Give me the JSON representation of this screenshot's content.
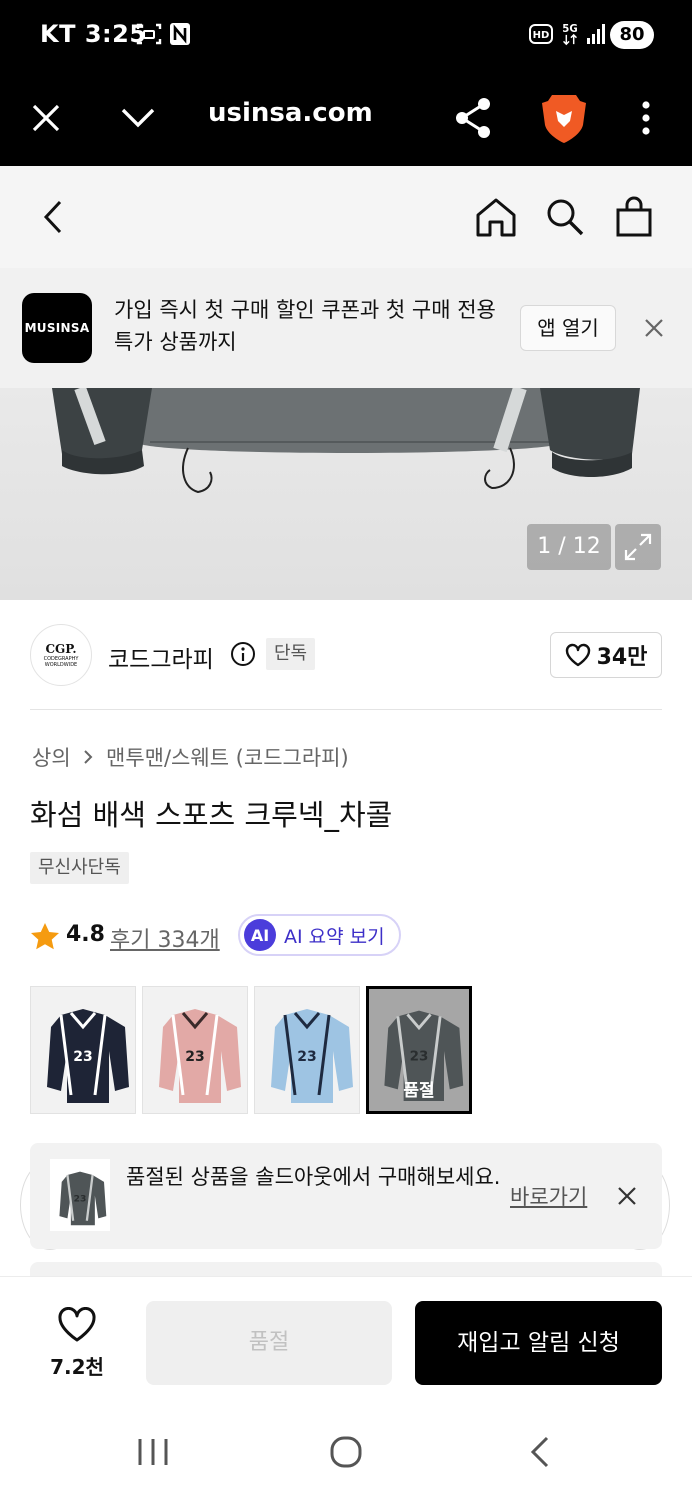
{
  "status_bar": {
    "carrier_time": "KT 3:25",
    "battery": "80"
  },
  "browser": {
    "url": "usinsa.com"
  },
  "app_banner": {
    "logo_text": "MUSINSA",
    "message": "가입 즉시 첫 구매 할인 쿠폰과 첫 구매 전용 특가 상품까지",
    "open_app_label": "앱 열기"
  },
  "gallery": {
    "counter": "1 / 12"
  },
  "brand": {
    "logo_main": "CGP.",
    "logo_sub": "CODEGRAPHY WORLDWIDE",
    "name": "코드그라피",
    "exclusive_tag": "단독",
    "like_count": "34만"
  },
  "breadcrumb": {
    "category": "상의",
    "subcategory": "맨투맨/스웨트 (코드그라피)"
  },
  "product": {
    "title": "화섬 배색 스포츠 크루넥_차콜",
    "tag": "무신사단독",
    "rating": "4.8",
    "reviews": "후기 334개",
    "ai_badge": "AI",
    "ai_label": "AI 요약 보기"
  },
  "options": [
    {
      "color": "#1e2436",
      "accent": "#ffffff",
      "number": "23"
    },
    {
      "color": "#e2a9a6",
      "accent": "#ffffff",
      "number": "23"
    },
    {
      "color": "#9ec4e3",
      "accent": "#ffffff",
      "number": "23"
    },
    {
      "color": "#4f5557",
      "accent": "#c9cccc",
      "number": "23",
      "sold_label": "품절"
    }
  ],
  "soldout_notice": {
    "message": "품절된 상품을 솔드아웃에서 구매해보세요.",
    "link": "바로가기"
  },
  "bottom_bar": {
    "like_count": "7.2천",
    "sold_out_label": "품절",
    "restock_label": "재입고 알림 신청"
  }
}
